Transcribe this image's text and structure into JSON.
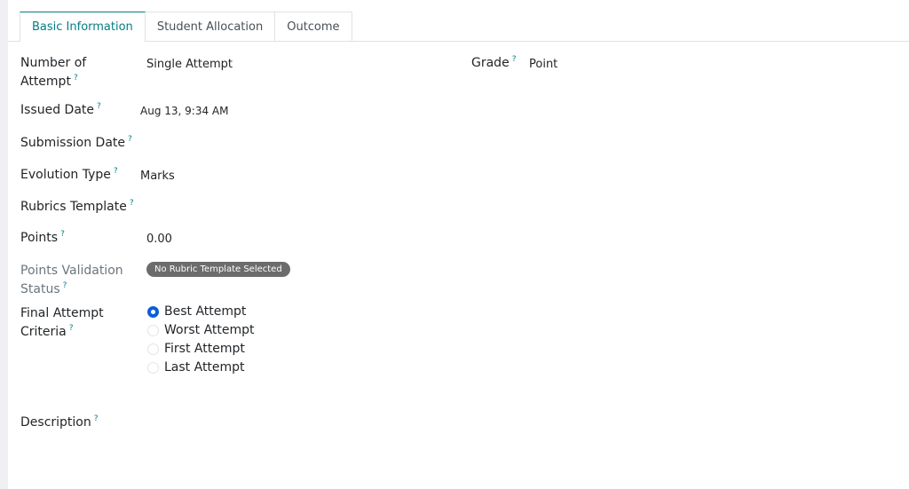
{
  "tabs": [
    {
      "label": "Basic Information",
      "active": true
    },
    {
      "label": "Student Allocation",
      "active": false
    },
    {
      "label": "Outcome",
      "active": false
    }
  ],
  "help_mark": "?",
  "fields": {
    "number_of_attempt": {
      "label_line1": "Number of",
      "label_line2": "Attempt",
      "value": "Single Attempt"
    },
    "grade": {
      "label": "Grade",
      "value": "Point"
    },
    "issued_date": {
      "label": "Issued Date",
      "value": "Aug 13, 9:34 AM"
    },
    "submission_date": {
      "label": "Submission Date",
      "value": ""
    },
    "evolution_type": {
      "label": "Evolution Type",
      "value": "Marks"
    },
    "rubrics_template": {
      "label": "Rubrics Template",
      "value": ""
    },
    "points": {
      "label": "Points",
      "value": "0.00"
    },
    "points_validation_status": {
      "label_line1": "Points Validation",
      "label_line2": "Status",
      "badge": "No Rubric Template Selected"
    },
    "final_attempt_criteria": {
      "label_line1": "Final Attempt",
      "label_line2": "Criteria",
      "options": [
        "Best Attempt",
        "Worst Attempt",
        "First Attempt",
        "Last Attempt"
      ],
      "selected": "Best Attempt"
    },
    "description": {
      "label": "Description"
    }
  },
  "colors": {
    "accent": "#017e84",
    "radio_selected": "#0b5ed7",
    "badge_bg": "#6c6c6c"
  }
}
